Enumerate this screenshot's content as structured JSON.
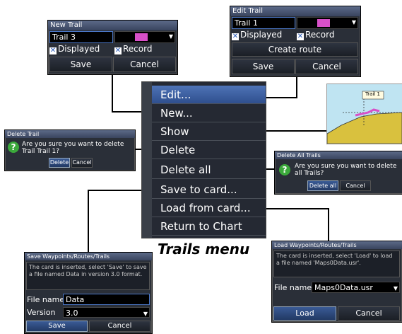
{
  "new_trail_dialog": {
    "title": "New Trail",
    "name_value": "Trail 3",
    "displayed_label": "Displayed",
    "record_label": "Record",
    "save_label": "Save",
    "cancel_label": "Cancel"
  },
  "edit_trail_dialog": {
    "title": "Edit Trail",
    "name_value": "Trail 1",
    "displayed_label": "Displayed",
    "record_label": "Record",
    "create_route_label": "Create route",
    "save_label": "Save",
    "cancel_label": "Cancel"
  },
  "delete_trail_dialog": {
    "title": "Delete Trail",
    "message": "Are you sure you want to delete Trail Trail 1?",
    "delete_label": "Delete",
    "cancel_label": "Cancel"
  },
  "delete_all_dialog": {
    "title": "Delete All Trails",
    "message": "Are you sure you want to delete all Trails?",
    "delete_all_label": "Delete all",
    "cancel_label": "Cancel"
  },
  "trails_menu": {
    "items": [
      {
        "label": "Edit..."
      },
      {
        "label": "New..."
      },
      {
        "label": "Show"
      },
      {
        "label": "Delete"
      },
      {
        "label": "Delete all"
      },
      {
        "label": "Save to card..."
      },
      {
        "label": "Load from card..."
      },
      {
        "label": "Return to Chart"
      }
    ],
    "caption": "Trails menu"
  },
  "chart_preview": {
    "trail_label": "Trail 1"
  },
  "save_dialog": {
    "title": "Save Waypoints/Routes/Trails",
    "info": "The card is inserted, select 'Save' to save a file named Data in version 3.0 format.",
    "file_name_label": "File name",
    "file_name_value": "Data",
    "version_label": "Version",
    "version_value": "3.0",
    "save_label": "Save",
    "cancel_label": "Cancel"
  },
  "load_dialog": {
    "title": "Load Waypoints/Routes/Trails",
    "info": "The card is inserted, select 'Load' to load a file named 'Maps0Data.usr'.",
    "file_name_label": "File name",
    "file_name_value": "Maps0Data.usr",
    "load_label": "Load",
    "cancel_label": "Cancel"
  },
  "colors": {
    "menu_bg": "#252933",
    "selected": "#4e73b6",
    "trail_color": "#d850c8",
    "question_icon": "#3ba93b"
  }
}
